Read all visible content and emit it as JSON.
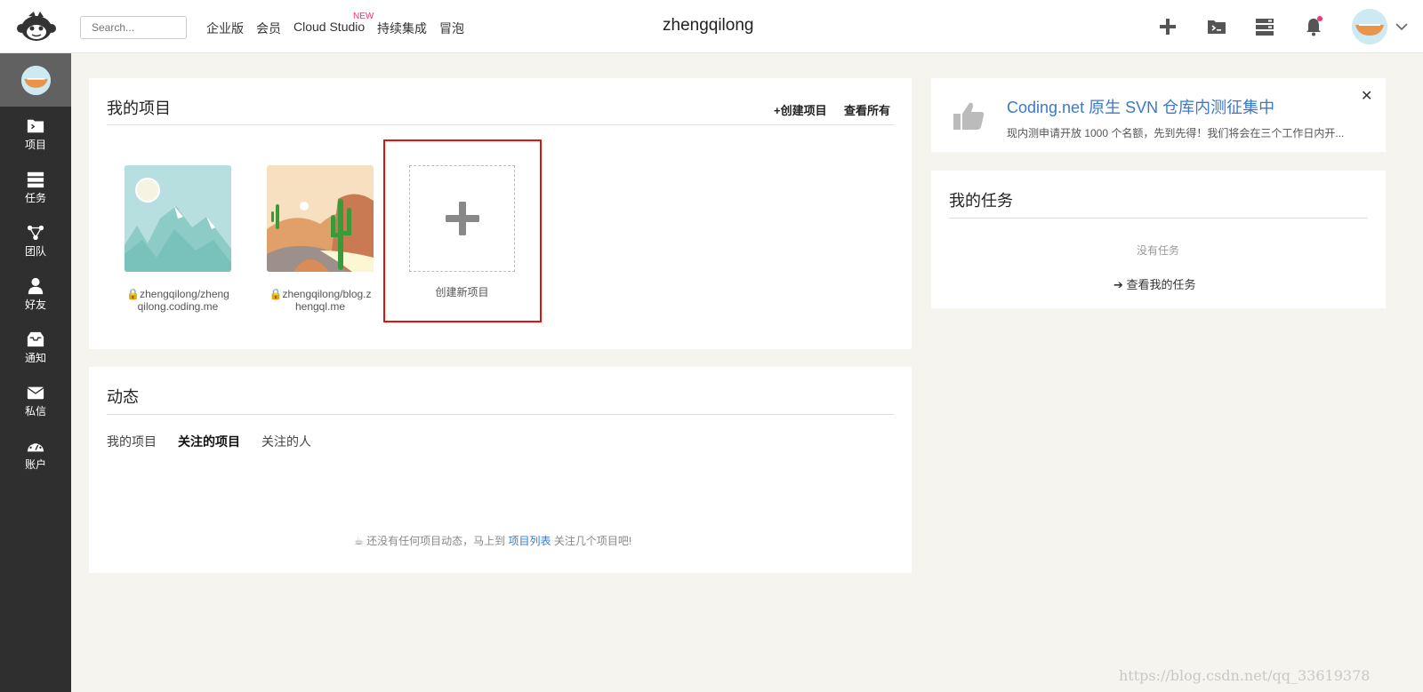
{
  "topbar": {
    "search_placeholder": "Search...",
    "nav": [
      "企业版",
      "会员",
      "Cloud Studio",
      "持续集成",
      "冒泡"
    ],
    "new_badge": "NEW",
    "username": "zhengqilong"
  },
  "sidebar": {
    "items": [
      {
        "label": "项目",
        "icon": "folder-icon"
      },
      {
        "label": "任务",
        "icon": "tasks-icon"
      },
      {
        "label": "团队",
        "icon": "team-icon"
      },
      {
        "label": "好友",
        "icon": "user-icon"
      },
      {
        "label": "通知",
        "icon": "inbox-icon"
      },
      {
        "label": "私信",
        "icon": "envelope-icon"
      },
      {
        "label": "账户",
        "icon": "dashboard-icon"
      }
    ]
  },
  "projects_panel": {
    "title": "我的项目",
    "create_link": "+创建项目",
    "view_all_link": "查看所有",
    "projects": [
      {
        "name": "zhengqilong/zhengqilong.coding.me",
        "line1": "zhengqilong/zheng",
        "line2": "qilong.coding.me"
      },
      {
        "name": "zhengqilong/blog.zhengql.me",
        "line1": "zhengqilong/blog.z",
        "line2": "hengql.me"
      }
    ],
    "new_project_label": "创建新项目"
  },
  "activity_panel": {
    "title": "动态",
    "tabs": [
      "我的项目",
      "关注的项目",
      "关注的人"
    ],
    "active_tab": "关注的项目",
    "empty_before": "还没有任何项目动态，马上到",
    "empty_link": "项目列表",
    "empty_after": "关注几个项目吧!"
  },
  "svn_banner": {
    "title": "Coding.net 原生 SVN 仓库内测征集中",
    "desc": "现内测申请开放 1000 个名额，先到先得！我们将会在三个工作日内开..."
  },
  "tasks_panel": {
    "title": "我的任务",
    "empty": "没有任务",
    "view_link": "查看我的任务"
  },
  "watermark": "https://blog.csdn.net/qq_33619378",
  "colors": {
    "accent_blue": "#3b79c8",
    "highlight_red": "#e3120b",
    "sidebar_bg": "#2f2f2f",
    "notify_dot": "#f0376f"
  }
}
